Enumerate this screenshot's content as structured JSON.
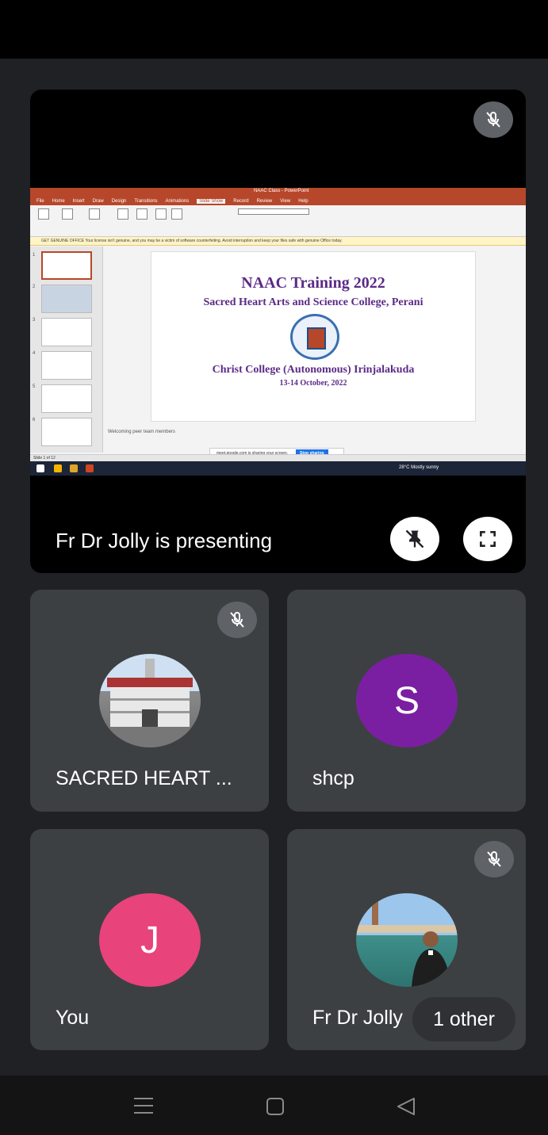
{
  "presenter_tile": {
    "label": "Fr Dr Jolly is presenting"
  },
  "shared_screen": {
    "window_title": "NAAC Class - PowerPoint",
    "tabs": [
      "File",
      "Home",
      "Insert",
      "Draw",
      "Design",
      "Transitions",
      "Animations",
      "Slide Show",
      "Record",
      "Review",
      "View",
      "Help"
    ],
    "active_tab": "Slide Show",
    "warning": "GET GENUINE OFFICE  Your license isn't genuine, and you may be a victim of software counterfeiting. Avoid interruption and keep your files safe with genuine Office today.",
    "slide": {
      "title": "NAAC Training 2022",
      "subtitle": "Sacred Heart Arts and Science College, Perani",
      "host": "Christ College (Autonomous) Irinjalakuda",
      "dates": "13-14 October, 2022"
    },
    "notes": "Welcoming peer team members",
    "share_banner": "meet.google.com is sharing your screen.",
    "stop_sharing": "Stop sharing",
    "status": "Slide 1 of 12",
    "taskbar_info": "28°C  Mostly sunny"
  },
  "participants": [
    {
      "name": "SACRED HEART ...",
      "avatar": "photo-building",
      "muted": true
    },
    {
      "name": "shcp",
      "initial": "S",
      "color": "#7b1fa2",
      "muted": false
    },
    {
      "name": "You",
      "initial": "J",
      "color": "#e8437a",
      "muted": false
    },
    {
      "name": "Fr Dr Jolly",
      "avatar": "photo-person",
      "muted": true
    }
  ],
  "others_pill": "1 other",
  "icons": {
    "mute": "mic-off-icon",
    "unpin": "unpin-icon",
    "fullscreen": "fullscreen-icon",
    "nav_recents": "recents-icon",
    "nav_home": "home-icon",
    "nav_back": "back-icon"
  }
}
